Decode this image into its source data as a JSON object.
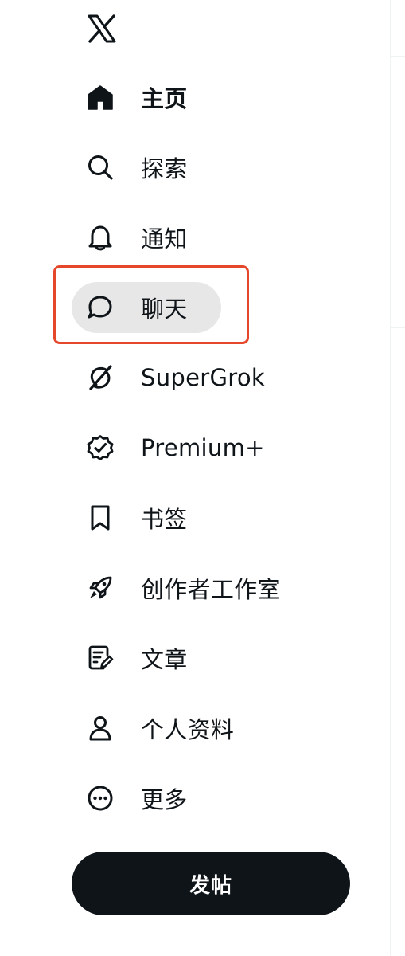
{
  "nav": {
    "items": [
      {
        "label": "主页",
        "icon": "home-icon",
        "bold": true
      },
      {
        "label": "探索",
        "icon": "search-icon"
      },
      {
        "label": "通知",
        "icon": "bell-icon"
      },
      {
        "label": "聊天",
        "icon": "chat-icon",
        "active": true
      },
      {
        "label": "SuperGrok",
        "icon": "grok-icon"
      },
      {
        "label": "Premium+",
        "icon": "verified-badge-icon"
      },
      {
        "label": "书签",
        "icon": "bookmark-icon"
      },
      {
        "label": "创作者工作室",
        "icon": "rocket-icon"
      },
      {
        "label": "文章",
        "icon": "article-icon"
      },
      {
        "label": "个人资料",
        "icon": "person-icon"
      },
      {
        "label": "更多",
        "icon": "more-circle-icon"
      }
    ]
  },
  "post_button": {
    "label": "发帖"
  },
  "colors": {
    "text": "#0f1419",
    "active_bg": "#e7e7e8",
    "highlight_border": "#e5472b",
    "button_bg": "#0f1419"
  }
}
